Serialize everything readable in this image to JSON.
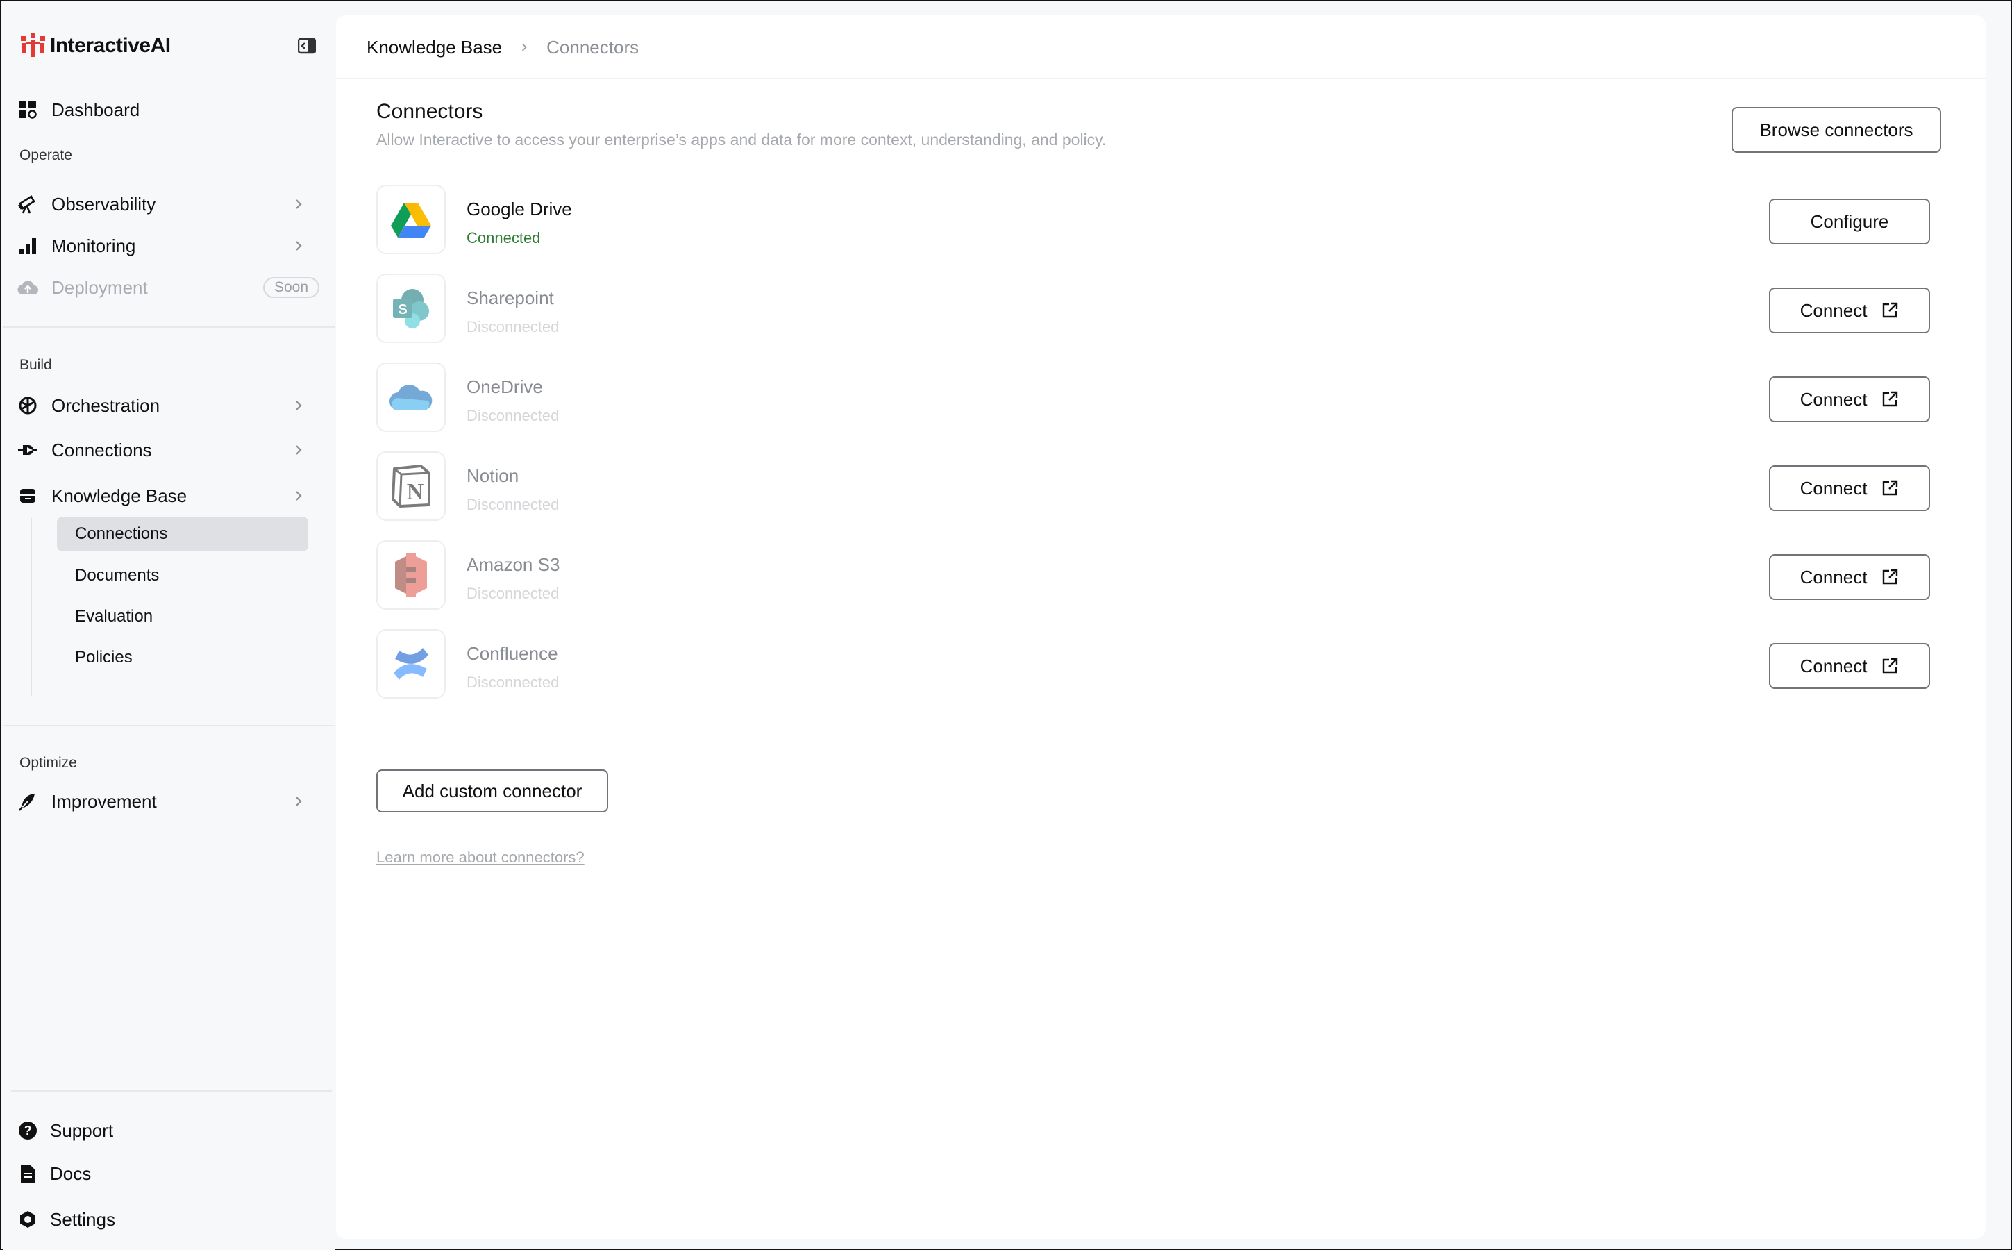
{
  "app": {
    "name": "InteractiveAI"
  },
  "sidebar": {
    "dashboard": "Dashboard",
    "sections": {
      "operate": "Operate",
      "build": "Build",
      "optimize": "Optimize"
    },
    "operate_items": [
      {
        "label": "Observability"
      },
      {
        "label": "Monitoring"
      },
      {
        "label": "Deployment",
        "badge": "Soon"
      }
    ],
    "build_items": [
      {
        "label": "Orchestration"
      },
      {
        "label": "Connections"
      },
      {
        "label": "Knowledge Base"
      }
    ],
    "knowledge_sub": [
      {
        "label": "Connections"
      },
      {
        "label": "Documents"
      },
      {
        "label": "Evaluation"
      },
      {
        "label": "Policies"
      }
    ],
    "optimize_items": [
      {
        "label": "Improvement"
      }
    ],
    "footer": [
      {
        "label": "Support"
      },
      {
        "label": "Docs"
      },
      {
        "label": "Settings"
      }
    ]
  },
  "breadcrumb": {
    "parent": "Knowledge Base",
    "current": "Connectors"
  },
  "page": {
    "title": "Connectors",
    "subtitle": "Allow Interactive to access your enterprise’s apps and data for more context, understanding, and policy.",
    "browse_button": "Browse connectors",
    "add_custom_button": "Add custom connector",
    "learn_more": "Learn more about connectors?"
  },
  "connectors": [
    {
      "name": "Google Drive",
      "status": "Connected",
      "action": "Configure"
    },
    {
      "name": "Sharepoint",
      "status": "Disconnected",
      "action": "Connect"
    },
    {
      "name": "OneDrive",
      "status": "Disconnected",
      "action": "Connect"
    },
    {
      "name": "Notion",
      "status": "Disconnected",
      "action": "Connect"
    },
    {
      "name": "Amazon S3",
      "status": "Disconnected",
      "action": "Connect"
    },
    {
      "name": "Confluence",
      "status": "Disconnected",
      "action": "Connect"
    }
  ],
  "colors": {
    "accent": "#e53935",
    "connected": "#2e7d32",
    "active_bg": "#dfe0e3"
  }
}
